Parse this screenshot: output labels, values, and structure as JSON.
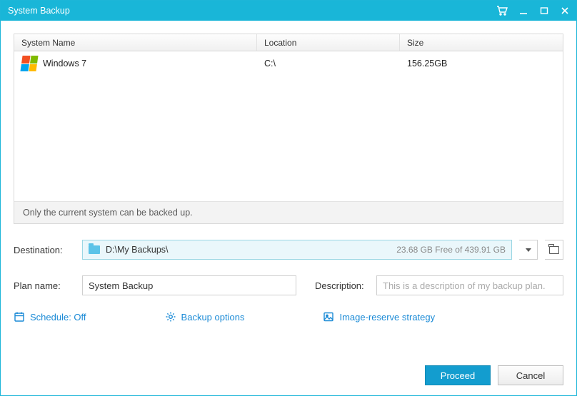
{
  "window": {
    "title": "System Backup"
  },
  "table": {
    "headers": {
      "name": "System Name",
      "location": "Location",
      "size": "Size"
    },
    "rows": [
      {
        "name": "Windows 7",
        "location": "C:\\",
        "size": "156.25GB"
      }
    ],
    "hint": "Only the current system can be backed up."
  },
  "destination": {
    "label": "Destination:",
    "path": "D:\\My Backups\\",
    "free": "23.68 GB Free of 439.91 GB"
  },
  "plan": {
    "label": "Plan name:",
    "value": "System Backup",
    "desc_label": "Description:",
    "desc_placeholder": "This is a description of my backup plan."
  },
  "links": {
    "schedule": "Schedule: Off",
    "options": "Backup options",
    "strategy": "Image-reserve strategy"
  },
  "buttons": {
    "proceed": "Proceed",
    "cancel": "Cancel"
  }
}
